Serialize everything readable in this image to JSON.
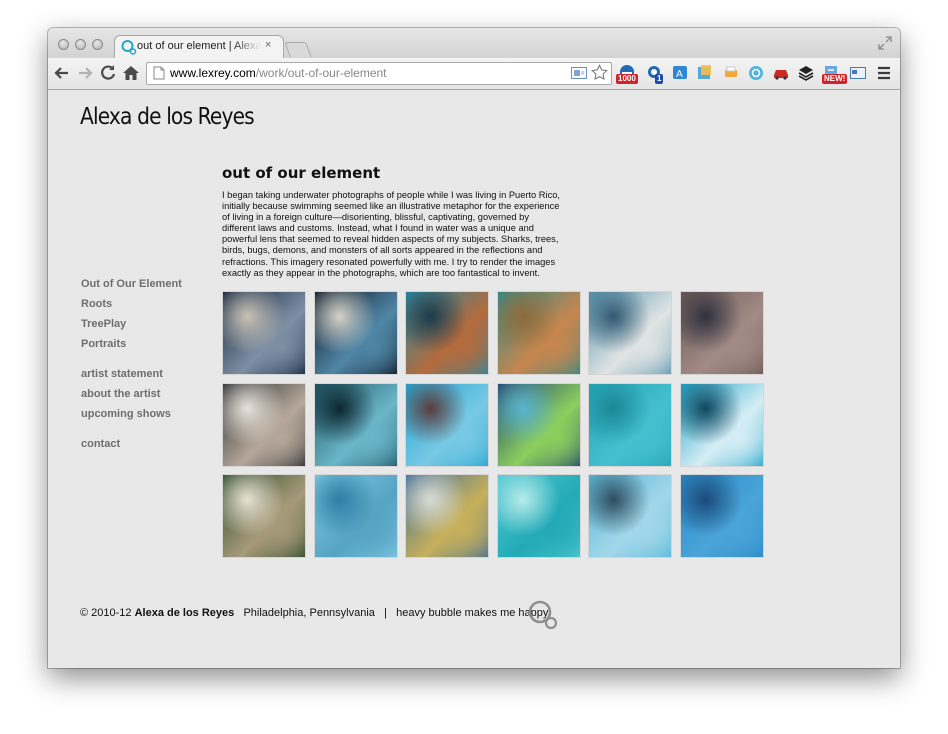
{
  "browser": {
    "tab_title": "out of our element | Alexa de los Reyes",
    "close_glyph": "×",
    "url_host": "www.lexrey.com",
    "url_path": "/work/out-of-our-element",
    "extension_badges": {
      "count_1000": "1000",
      "count_1": "1",
      "new": "NEW!"
    }
  },
  "site": {
    "title": "Alexa de los Reyes",
    "nav_primary": [
      "Out of Our Element",
      "Roots",
      "TreePlay",
      "Portraits"
    ],
    "nav_secondary": [
      "artist statement",
      "about the artist",
      "upcoming shows"
    ],
    "nav_contact": "contact"
  },
  "work": {
    "title": "out of our element",
    "description": "I began taking underwater photographs of people while I was living in Puerto Rico, initially because swimming seemed like an illustrative metaphor for the experience of living in a foreign culture—disorienting, blissful, captivating, governed by different laws and customs. Instead, what I found in water was a unique and powerful lens that seemed to reveal hidden aspects of my subjects. Sharks, trees, birds, bugs, demons, and monsters of all sorts appeared in the reflections and refractions. This imagery resonated powerfully with me. I try to render the images exactly as they appear in the photographs, which are too fantastical to invent."
  },
  "footer": {
    "copyright": "© 2010-12",
    "name": "Alexa de los Reyes",
    "location": "Philadelphia, Pennsylvania",
    "separator": "|",
    "tagline": "heavy bubble makes me happy"
  },
  "thumbnails": [
    {
      "c1": "#15243d",
      "c2": "#7d8fa3",
      "c3": "#c9c2b6"
    },
    {
      "c1": "#0f1727",
      "c2": "#4f86a5",
      "c3": "#d6d2c7"
    },
    {
      "c1": "#2a8aa3",
      "c2": "#b46b3c",
      "c3": "#1c3a4a"
    },
    {
      "c1": "#2f8a8a",
      "c2": "#c7864e",
      "c3": "#8e6b3b"
    },
    {
      "c1": "#5a96b0",
      "c2": "#e0e4e4",
      "c3": "#305a73"
    },
    {
      "c1": "#6a5a55",
      "c2": "#a38b85",
      "c3": "#2f3140"
    },
    {
      "c1": "#2a2c2e",
      "c2": "#b5a79a",
      "c3": "#e7e3dc"
    },
    {
      "c1": "#1f5766",
      "c2": "#6ab6c8",
      "c3": "#0e2630"
    },
    {
      "c1": "#25a6d3",
      "c2": "#78c9e4",
      "c3": "#5a3c3c"
    },
    {
      "c1": "#22446e",
      "c2": "#8ccf5d",
      "c3": "#58b4cf"
    },
    {
      "c1": "#24a6b8",
      "c2": "#45c0cf",
      "c3": "#1b8896"
    },
    {
      "c1": "#1ea4c8",
      "c2": "#d6eef5",
      "c3": "#0d4760"
    },
    {
      "c1": "#2c4a2a",
      "c2": "#a79a7a",
      "c3": "#e7e3d4"
    },
    {
      "c1": "#7fc9e3",
      "c2": "#56a3c3",
      "c3": "#2d7ea4"
    },
    {
      "c1": "#3f6f98",
      "c2": "#c7b05a",
      "c3": "#d9dcd8"
    },
    {
      "c1": "#4fc9d0",
      "c2": "#23aab6",
      "c3": "#b8ebeb"
    },
    {
      "c1": "#55b8d8",
      "c2": "#a3d7ea",
      "c3": "#2f4c5e"
    },
    {
      "c1": "#2a89c5",
      "c2": "#4aa4d9",
      "c3": "#1a4a7a"
    }
  ]
}
